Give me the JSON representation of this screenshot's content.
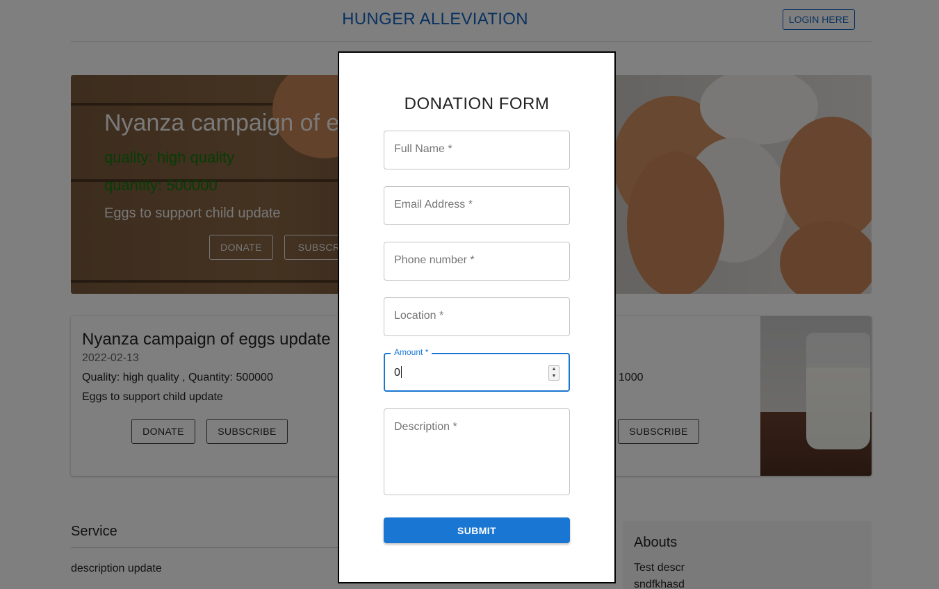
{
  "header": {
    "site_title": "HUNGER ALLEVIATION",
    "login_label": "LOGIN HERE"
  },
  "hero": {
    "title": "Nyanza campaign of e",
    "quality": "quality: high quality",
    "quantity": "quantity: 500000",
    "description": "Eggs to support child update",
    "donate_label": "DONATE",
    "subscribe_label": "SUBSCR"
  },
  "cards": [
    {
      "title": "Nyanza campaign of eggs update",
      "date": "2022-02-13",
      "meta": "Quality: high quality , Quantity: 500000",
      "description": "Eggs to support child update",
      "donate_label": "DONATE",
      "subscribe_label": "SUBSCRIBE"
    },
    {
      "meta_fragment": "y: 1000",
      "subscribe_label": "SUBSCRIBE"
    }
  ],
  "service": {
    "title": "Service",
    "description": "description update"
  },
  "abouts": {
    "title": "Abouts",
    "line1": "Test descr",
    "line2": "sndfkhasd"
  },
  "modal": {
    "title": "DONATION FORM",
    "fields": {
      "full_name": "Full Name *",
      "email": "Email Address *",
      "phone": "Phone number *",
      "location": "Location *",
      "amount_label": "Amount *",
      "amount_value": "0",
      "description": "Description *"
    },
    "submit_label": "SUBMIT"
  },
  "colors": {
    "brand_blue": "#1565c0",
    "primary_button": "#1976d2",
    "quality_text_green": "#0a7a0a"
  }
}
